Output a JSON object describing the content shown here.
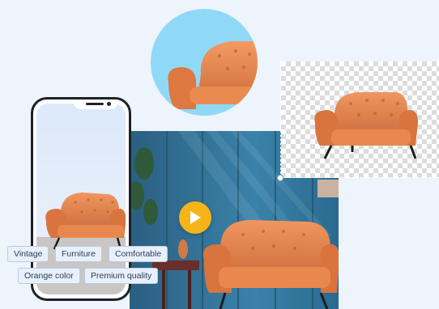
{
  "tags": {
    "row1": [
      "Vintage",
      "Furniture",
      "Comfortable"
    ],
    "row2": [
      "Orange color",
      "Premium quality"
    ]
  },
  "colors": {
    "background": "#eef4fc",
    "circle_bg": "#8fd9f7",
    "wall": "#2f6f94",
    "chair": "#e0824c",
    "play_button": "#f5b418",
    "tag_bg": "#e8f0fb"
  },
  "icons": {
    "play": "play-icon"
  }
}
